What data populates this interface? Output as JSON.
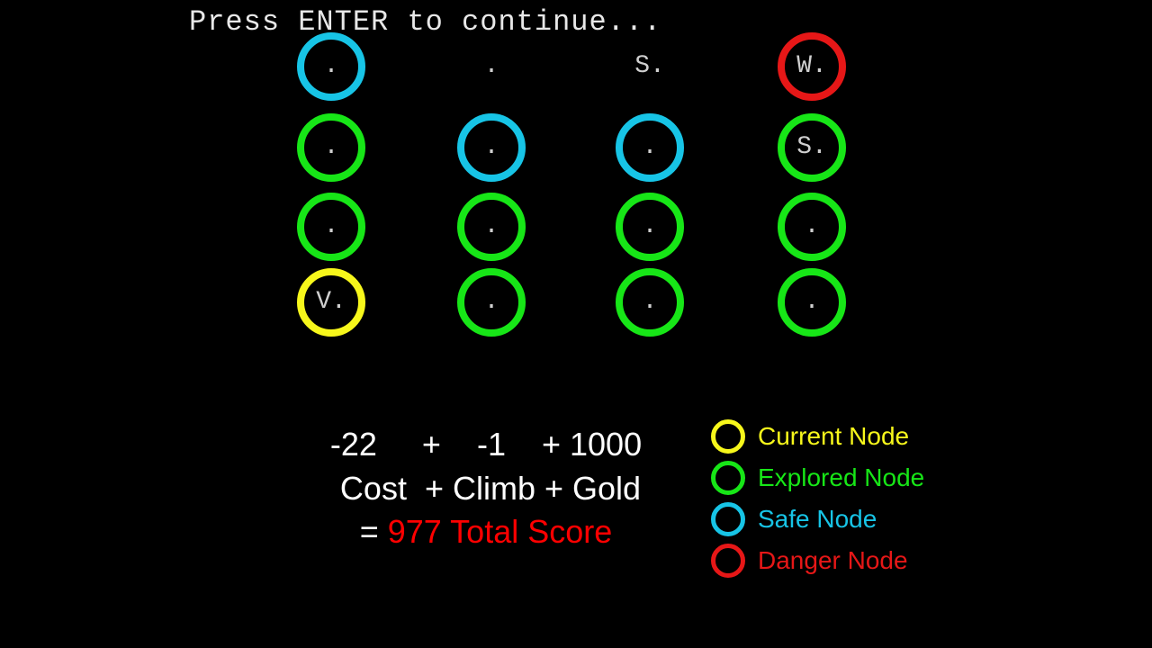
{
  "prompt": "Press ENTER to continue...",
  "colors": {
    "current": "#f7f71b",
    "explored": "#17e617",
    "safe": "#17c4e6",
    "danger": "#e61717"
  },
  "grid": {
    "cols": [
      178,
      356,
      532,
      712
    ],
    "rows": [
      36,
      126,
      214,
      298
    ],
    "cells": [
      [
        {
          "label": ".",
          "ring": "cyan"
        },
        {
          "label": ".",
          "ring": null
        },
        {
          "label": "S.",
          "ring": null
        },
        {
          "label": "W.",
          "ring": "red"
        }
      ],
      [
        {
          "label": ".",
          "ring": "green"
        },
        {
          "label": ".",
          "ring": "cyan"
        },
        {
          "label": ".",
          "ring": "cyan"
        },
        {
          "label": "S.",
          "ring": "green"
        }
      ],
      [
        {
          "label": ".",
          "ring": "green"
        },
        {
          "label": ".",
          "ring": "green"
        },
        {
          "label": ".",
          "ring": "green"
        },
        {
          "label": ".",
          "ring": "green"
        }
      ],
      [
        {
          "label": "V.",
          "ring": "yellow"
        },
        {
          "label": ".",
          "ring": "green"
        },
        {
          "label": ".",
          "ring": "green"
        },
        {
          "label": ".",
          "ring": "green"
        }
      ]
    ]
  },
  "formula": {
    "values_line": "-22     +    -1    + 1000",
    "labels_line": " Cost  + Climb + Gold",
    "equals": "= ",
    "result": "977 Total Score"
  },
  "legend": {
    "current": "Current Node",
    "explored": "Explored Node",
    "safe": "Safe Node",
    "danger": "Danger Node"
  }
}
